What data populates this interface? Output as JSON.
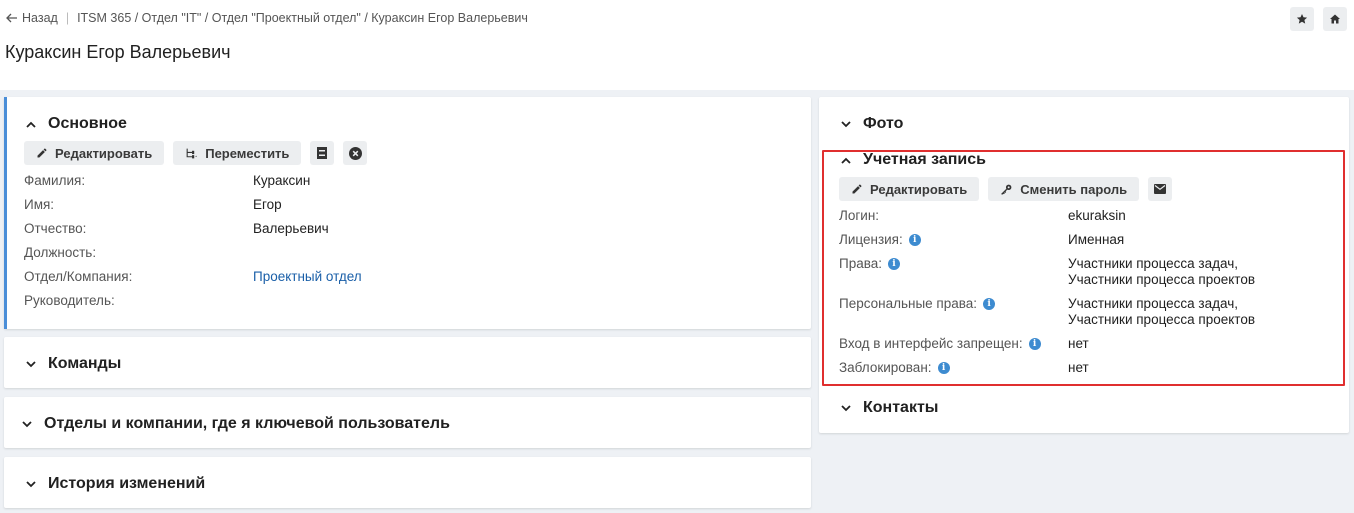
{
  "header": {
    "back_label": "Назад",
    "breadcrumb": "ITSM 365 / Отдел \"IT\" / Отдел \"Проектный отдел\" / Кураксин Егор Валерьевич",
    "title": "Кураксин Егор Валерьевич"
  },
  "main": {
    "title": "Основное",
    "buttons": {
      "edit": "Редактировать",
      "move": "Переместить"
    },
    "fields": [
      {
        "label": "Фамилия:",
        "value": "Кураксин"
      },
      {
        "label": "Имя:",
        "value": "Егор"
      },
      {
        "label": "Отчество:",
        "value": "Валерьевич"
      },
      {
        "label": "Должность:",
        "value": ""
      },
      {
        "label": "Отдел/Компания:",
        "value": "Проектный отдел"
      },
      {
        "label": "Руководитель:",
        "value": ""
      }
    ]
  },
  "sections": {
    "teams": "Команды",
    "departments": "Отделы и компании, где я ключевой пользователь",
    "history": "История изменений",
    "photo": "Фото",
    "contacts": "Контакты"
  },
  "account": {
    "title": "Учетная запись",
    "buttons": {
      "edit": "Редактировать",
      "change_password": "Сменить пароль"
    },
    "fields": [
      {
        "label": "Логин:",
        "value": "ekuraksin"
      },
      {
        "label": "Лицензия:",
        "value": "Именная"
      },
      {
        "label": "Права:",
        "value_line1": "Участники процесса задач,",
        "value_line2": "Участники процесса проектов"
      },
      {
        "label": "Персональные права:",
        "value_line1": "Участники процесса задач,",
        "value_line2": "Участники процесса проектов"
      },
      {
        "label": "Вход в интерфейс запрещен:",
        "value": "нет"
      },
      {
        "label": "Заблокирован:",
        "value": "нет"
      }
    ]
  },
  "icons": {
    "back": "arrow-left-icon",
    "star": "star-icon",
    "home": "home-icon",
    "pencil": "pencil-icon",
    "move": "tree-move-icon",
    "archive": "archive-icon",
    "delete": "close-circle-icon",
    "key": "key-icon",
    "mail": "mail-icon",
    "info": "info-icon",
    "chevron_up": "chevron-up-icon",
    "chevron_down": "chevron-down-icon"
  },
  "colors": {
    "link": "#1a5fa8",
    "accent": "#4a8ed8",
    "highlight": "#e02f2f",
    "info": "#3d8bd0",
    "background": "#eef1f5"
  }
}
